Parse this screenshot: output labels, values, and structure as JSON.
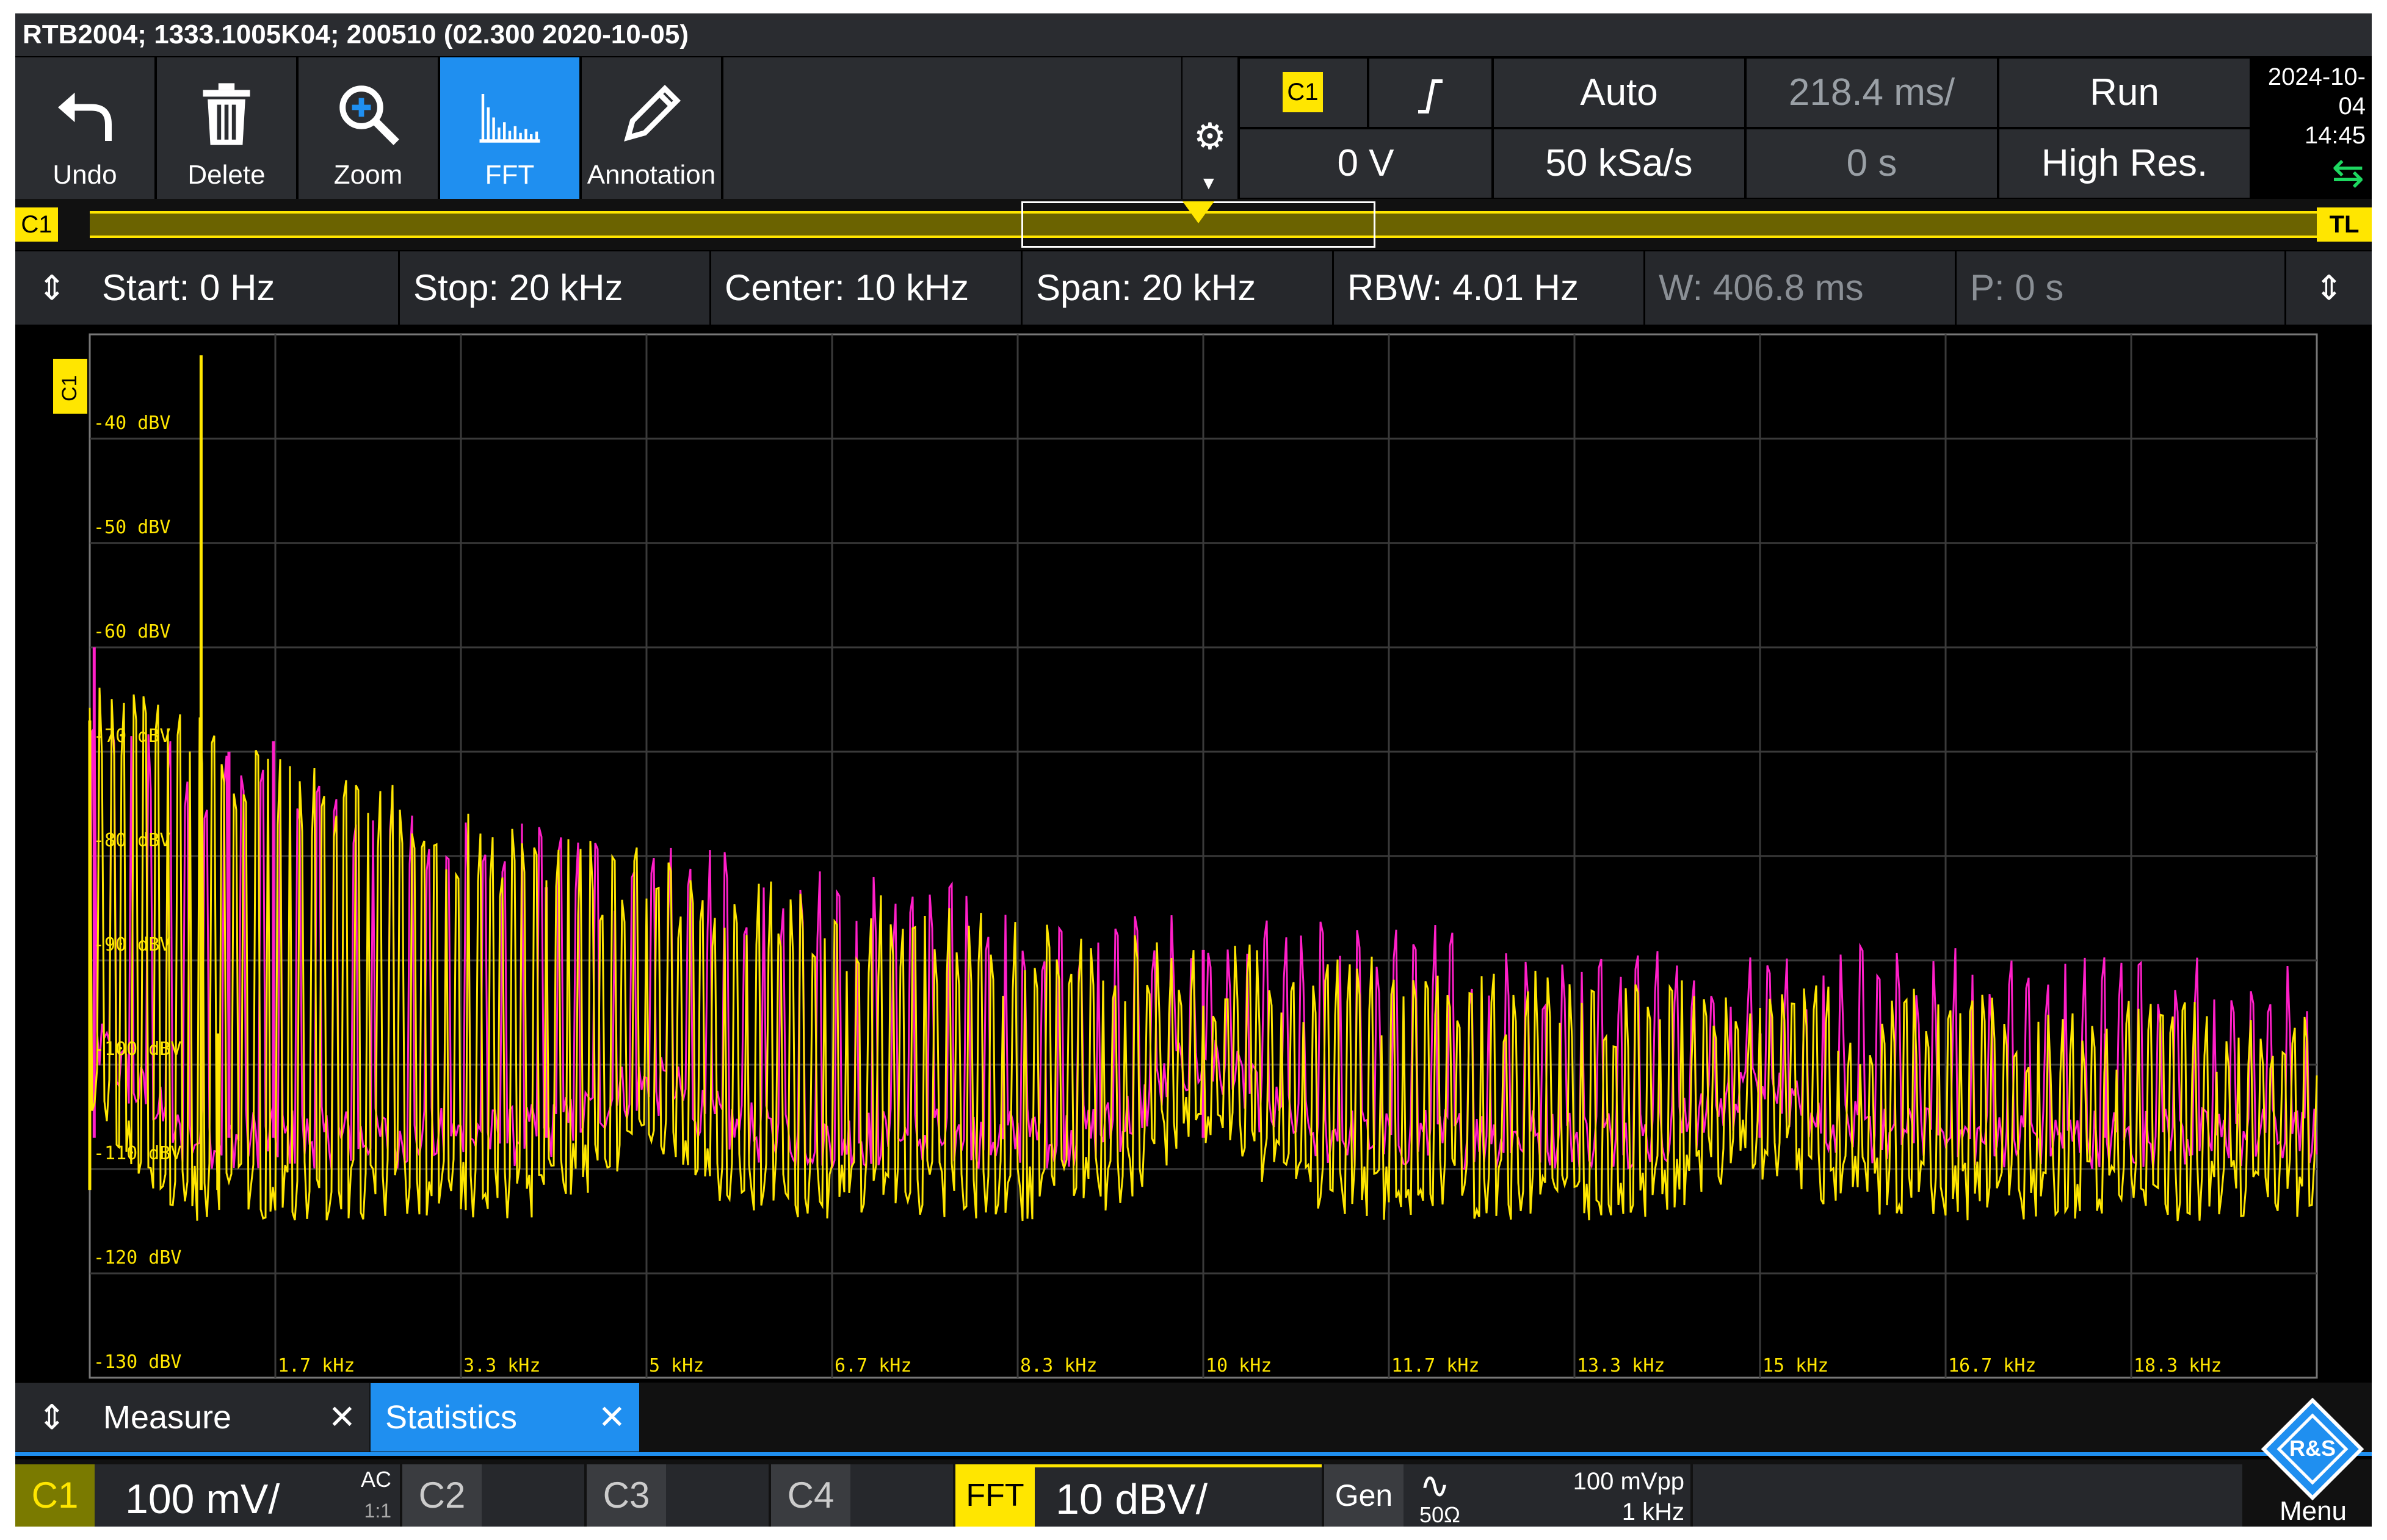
{
  "device_title": "RTB2004; 1333.1005K04; 200510 (02.300 2020-10-05)",
  "toolbar": {
    "buttons": [
      {
        "label": "Undo",
        "icon": "undo-icon"
      },
      {
        "label": "Delete",
        "icon": "trash-icon"
      },
      {
        "label": "Zoom",
        "icon": "zoom-icon"
      },
      {
        "label": "FFT",
        "icon": "fft-icon"
      },
      {
        "label": "Annotation",
        "icon": "pencil-icon"
      }
    ],
    "active": "FFT"
  },
  "trigger": {
    "source": "C1",
    "slope_icon": "rising-edge-icon",
    "mode": "Auto",
    "timebase": "218.4 ms/",
    "run_state": "Run",
    "level": "0 V",
    "sample_rate": "50 kSa/s",
    "position": "0 s",
    "acquisition": "High Res."
  },
  "datetime": {
    "date": "2024-10-04",
    "time": "14:45"
  },
  "overview": {
    "channel": "C1",
    "marker": "TL"
  },
  "fft_settings": {
    "start": "Start: 0 Hz",
    "stop": "Stop: 20 kHz",
    "center": "Center: 10 kHz",
    "span": "Span: 20 kHz",
    "rbw": "RBW: 4.01 Hz",
    "window": "W: 406.8 ms",
    "position": "P: 0 s"
  },
  "chart_data": {
    "type": "line",
    "channel_marker": "C1",
    "y_tick_labels": [
      "-40 dBV",
      "-50 dBV",
      "-60 dBV",
      "-70 dBV",
      "-80 dBV",
      "-90 dBV",
      "-100 dBV",
      "-110 dBV",
      "-120 dBV",
      "-130 dBV"
    ],
    "x_tick_labels": [
      "1.7 kHz",
      "3.3 kHz",
      "5 kHz",
      "6.7 kHz",
      "8.3 kHz",
      "10 kHz",
      "11.7 kHz",
      "13.3 kHz",
      "15 kHz",
      "16.7 kHz",
      "18.3 kHz"
    ],
    "xlim_hz": [
      0,
      20000
    ],
    "ylim_dbv": [
      -133,
      -33
    ],
    "grid": true,
    "colors": {
      "yellow": "#ffe600",
      "magenta": "#ff1fc8",
      "grid": "#3a3a3a"
    },
    "series": [
      {
        "color": "#ffe600",
        "noise_floor_dbv": -115,
        "peaks": [
          {
            "x_hz": 1000,
            "y_dbv": -35
          },
          {
            "x_hz": 0,
            "y_dbv": -70
          },
          {
            "x_hz": 1150,
            "y_dbv": -100
          }
        ]
      },
      {
        "color": "#ff1fc8",
        "noise_floor_dbv": -110,
        "peaks": [
          {
            "x_hz": 40,
            "y_dbv": -63
          },
          {
            "x_hz": 1250,
            "y_dbv": -73
          },
          {
            "x_hz": 1650,
            "y_dbv": -72
          },
          {
            "x_hz": 4100,
            "y_dbv": -86
          },
          {
            "x_hz": 10000,
            "y_dbv": -92
          },
          {
            "x_hz": 15000,
            "y_dbv": -100
          },
          {
            "x_hz": 18100,
            "y_dbv": -100
          }
        ]
      }
    ]
  },
  "bottom_tabs": [
    {
      "label": "Measure"
    },
    {
      "label": "Statistics"
    }
  ],
  "channels": {
    "c1": {
      "name": "C1",
      "scale": "100 mV/",
      "coupling": "AC",
      "probe": "1:1"
    },
    "c2": {
      "name": "C2"
    },
    "c3": {
      "name": "C3"
    },
    "c4": {
      "name": "C4"
    },
    "fft": {
      "name": "FFT",
      "scale": "10 dBV/"
    },
    "gen": {
      "name": "Gen",
      "impedance": "50Ω",
      "amplitude": "100 mVpp",
      "frequency": "1 kHz"
    }
  },
  "menu_label": "Menu",
  "logo_text": "R&S"
}
